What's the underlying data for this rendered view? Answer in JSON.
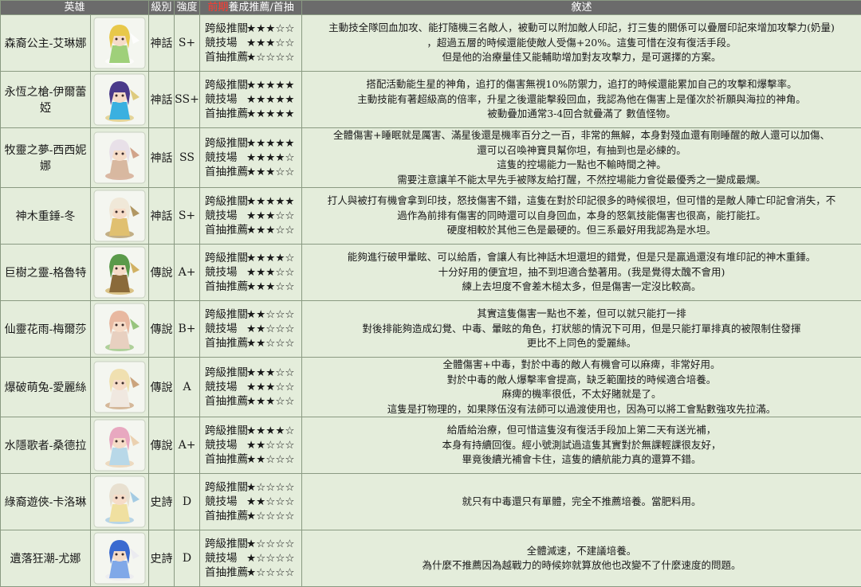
{
  "header": {
    "hero": "英雄",
    "level": "級別",
    "strength": "強度",
    "rec_red": "前期",
    "rec_rest": "養成推薦/首抽",
    "desc": "敘述"
  },
  "heroes": [
    {
      "name": "森裔公主-艾琳娜",
      "rarity": "神話",
      "grade": "S+",
      "colors": {
        "hair": "#e8c84a",
        "body": "#9fd07a",
        "accent": "#ffffff"
      },
      "ratings": [
        {
          "label": "跨級推關",
          "stars": "★★★☆☆"
        },
        {
          "label": "競技場",
          "stars": "★★★☆☆"
        },
        {
          "label": "首抽推薦",
          "stars": "★☆☆☆☆"
        }
      ],
      "desc": [
        "主動技全隊回血加攻、能打隨機三名敵人，被動可以附加敵人印記，打三隻的關係可以疊層印記來增加攻擊力(奶量)",
        "，超過五層的時候還能使敵人受傷+20%。這隻可惜在沒有復活手段。",
        "但是他的治療量佳又能輔助增加對友攻擊力，是可選擇的方案。"
      ]
    },
    {
      "name": "永恆之槍-伊爾蕾婭",
      "rarity": "神話",
      "grade": "SS+",
      "colors": {
        "hair": "#4a3a8a",
        "body": "#3ab0e0",
        "accent": "#d8c060"
      },
      "ratings": [
        {
          "label": "跨級推關",
          "stars": "★★★★★"
        },
        {
          "label": "競技場",
          "stars": "★★★★★"
        },
        {
          "label": "首抽推薦",
          "stars": "★★★★★"
        }
      ],
      "desc": [
        "搭配活動能生星的神角，追打的傷害無視10%防禦力，追打的時候還能累加自己的攻擊和爆擊率。",
        "主動技能有著超級高的倍率，升星之後還能擊殺回血，我認為他在傷害上是僅次於祈願與海拉的神角。",
        "被動疊加通常3-4回合就疊滿了 數值怪物。"
      ]
    },
    {
      "name": "牧靈之夢-西西妮娜",
      "rarity": "神話",
      "grade": "SS",
      "colors": {
        "hair": "#e8e0e8",
        "body": "#d8b8a0",
        "accent": "#c89070"
      },
      "ratings": [
        {
          "label": "跨級推關",
          "stars": "★★★★★"
        },
        {
          "label": "競技場",
          "stars": "★★★★☆"
        },
        {
          "label": "首抽推薦",
          "stars": "★★★☆☆"
        }
      ],
      "desc": [
        "全體傷害+睡眠就是厲害、滿星後還是機率百分之一百，非常的無解，本身對殘血還有剛睡醒的敵人還可以加傷、",
        "還可以召喚神寶貝幫你坦，有抽到也是必練的。",
        "這隻的控場能力一點也不輸時間之神。",
        "需要注意讓羊不能太早先手被隊友給打醒，不然控場能力會從最優秀之一變成最爛。"
      ]
    },
    {
      "name": "神木重錘-冬",
      "rarity": "神話",
      "grade": "S+",
      "colors": {
        "hair": "#f0e8d8",
        "body": "#e0c070",
        "accent": "#a08040"
      },
      "ratings": [
        {
          "label": "跨級推關",
          "stars": "★★★★★"
        },
        {
          "label": "競技場",
          "stars": "★★★☆☆"
        },
        {
          "label": "首抽推薦",
          "stars": "★★★☆☆"
        }
      ],
      "desc": [
        "打人與被打有機會拿到印技，怒技傷害不錯，這隻在對於印記很多的時候很坦，但可惜的是敵人陣亡印記會消失，不",
        "過作為前排有傷害的同時還可以自身回血，本身的怒氣技能傷害也很高，能打能扛。",
        "硬度相較於其他三色是最硬的。但三系最好用我認為是水坦。"
      ]
    },
    {
      "name": "巨樹之靈-格魯特",
      "rarity": "傳說",
      "grade": "A+",
      "colors": {
        "hair": "#5a9a4a",
        "body": "#8a6a3a",
        "accent": "#c8a040"
      },
      "ratings": [
        {
          "label": "跨級推關",
          "stars": "★★★★☆"
        },
        {
          "label": "競技場",
          "stars": "★★★☆☆"
        },
        {
          "label": "首抽推薦",
          "stars": "★★★☆☆"
        }
      ],
      "desc": [
        "能夠進行破甲暈眩、可以給盾，會讓人有比神話木坦還坦的錯覺，但是只是贏過還沒有堆印記的神木重錘。",
        "十分好用的便宜坦，抽不到坦適合墊著用。(我是覺得太醜不會用)",
        "練上去坦度不會差木槌太多，但是傷害一定沒比較高。"
      ]
    },
    {
      "name": "仙靈花雨-梅爾莎",
      "rarity": "傳說",
      "grade": "B+",
      "colors": {
        "hair": "#e8b8a0",
        "body": "#e8d0c0",
        "accent": "#80b860"
      },
      "ratings": [
        {
          "label": "跨級推關",
          "stars": "★★☆☆☆"
        },
        {
          "label": "競技場",
          "stars": "★★☆☆☆"
        },
        {
          "label": "首抽推薦",
          "stars": "★★☆☆☆"
        }
      ],
      "desc": [
        "其實這隻傷害一點也不差，但可以就只能打一排",
        "對後排能夠造成幻覺、中毒、暈眩的角色，打狀態的情況下可用，但是只能打單排真的被限制住發揮",
        "更比不上同色的愛麗絲。"
      ]
    },
    {
      "name": "爆破萌兔-愛麗絲",
      "rarity": "傳說",
      "grade": "A",
      "colors": {
        "hair": "#f0e0b0",
        "body": "#f0e8e0",
        "accent": "#c09060"
      },
      "ratings": [
        {
          "label": "跨級推關",
          "stars": "★★★☆☆"
        },
        {
          "label": "競技場",
          "stars": "★★★☆☆"
        },
        {
          "label": "首抽推薦",
          "stars": "★★★☆☆"
        }
      ],
      "desc": [
        "全體傷害+中毒，對於中毒的敵人有機會可以麻痺，非常好用。",
        "對於中毒的敵人爆擊率會提高，缺乏範圍技的時候適合培養。",
        "麻痺的機率很低，不太好賭就是了。",
        "這隻是打物理的，如果隊伍沒有法師可以過渡使用也，因為可以將工會點數強攻先拉滿。"
      ]
    },
    {
      "name": "水隱歌者-桑德拉",
      "rarity": "傳說",
      "grade": "A+",
      "colors": {
        "hair": "#e8a8c0",
        "body": "#b8d8e8",
        "accent": "#e8c8a0"
      },
      "ratings": [
        {
          "label": "跨級推關",
          "stars": "★★★★☆"
        },
        {
          "label": "競技場",
          "stars": "★★☆☆☆"
        },
        {
          "label": "首抽推薦",
          "stars": "★★☆☆☆"
        }
      ],
      "desc": [
        "給盾給治療，但可惜這隻沒有復活手段加上第二天有送光補，",
        "本身有持續回復。經小號測試過這隻其實對於無課輕課很友好，",
        "畢竟後續光補會卡住，這隻的續航能力真的還算不錯。"
      ]
    },
    {
      "name": "綠裔遊俠-卡洛琳",
      "rarity": "史詩",
      "grade": "D",
      "colors": {
        "hair": "#e8e0d0",
        "body": "#f0e0a0",
        "accent": "#90c0e0"
      },
      "ratings": [
        {
          "label": "跨級推關",
          "stars": "★☆☆☆☆"
        },
        {
          "label": "競技場",
          "stars": "★★☆☆☆"
        },
        {
          "label": "首抽推薦",
          "stars": "★☆☆☆☆"
        }
      ],
      "desc": [
        "就只有中毒還只有單體，完全不推薦培養。當肥料用。"
      ]
    },
    {
      "name": "遺落狂潮-尤娜",
      "rarity": "史詩",
      "grade": "D",
      "colors": {
        "hair": "#3a6ad0",
        "body": "#80a8e8",
        "accent": "#e8e8f0"
      },
      "ratings": [
        {
          "label": "跨級推關",
          "stars": "★☆☆☆☆"
        },
        {
          "label": "競技場",
          "stars": "★☆☆☆☆"
        },
        {
          "label": "首抽推薦",
          "stars": "★☆☆☆☆"
        }
      ],
      "desc": [
        "全體減速，不建議培養。",
        "為什麼不推薦因為越戰力的時候妳就算放他也改變不了什麼速度的問題。"
      ]
    }
  ]
}
